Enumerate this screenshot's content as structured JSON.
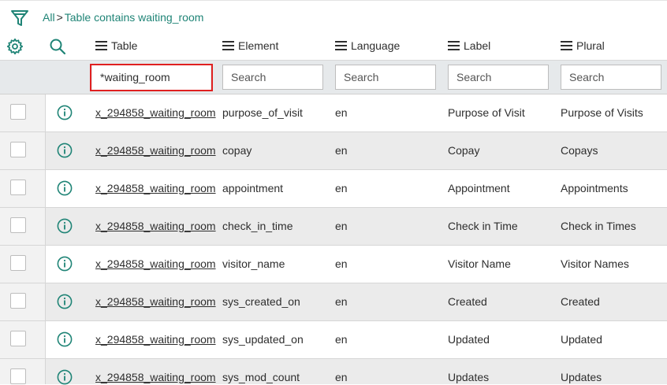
{
  "breadcrumb": {
    "all": "All",
    "separator": ">",
    "condition": "Table contains waiting_room"
  },
  "columns": [
    {
      "label": "Table",
      "search_value": "*waiting_room",
      "search_placeholder": "Search"
    },
    {
      "label": "Element",
      "search_value": "",
      "search_placeholder": "Search"
    },
    {
      "label": "Language",
      "search_value": "",
      "search_placeholder": "Search"
    },
    {
      "label": "Label",
      "search_value": "",
      "search_placeholder": "Search"
    },
    {
      "label": "Plural",
      "search_value": "",
      "search_placeholder": "Search"
    }
  ],
  "rows": [
    {
      "table": "x_294858_waiting_room",
      "element": "purpose_of_visit",
      "language": "en",
      "label": "Purpose of Visit",
      "plural": "Purpose of Visits"
    },
    {
      "table": "x_294858_waiting_room",
      "element": "copay",
      "language": "en",
      "label": "Copay",
      "plural": "Copays"
    },
    {
      "table": "x_294858_waiting_room",
      "element": "appointment",
      "language": "en",
      "label": "Appointment",
      "plural": "Appointments"
    },
    {
      "table": "x_294858_waiting_room",
      "element": "check_in_time",
      "language": "en",
      "label": "Check in Time",
      "plural": "Check in Times"
    },
    {
      "table": "x_294858_waiting_room",
      "element": "visitor_name",
      "language": "en",
      "label": "Visitor Name",
      "plural": "Visitor Names"
    },
    {
      "table": "x_294858_waiting_room",
      "element": "sys_created_on",
      "language": "en",
      "label": "Created",
      "plural": "Created"
    },
    {
      "table": "x_294858_waiting_room",
      "element": "sys_updated_on",
      "language": "en",
      "label": "Updated",
      "plural": "Updated"
    },
    {
      "table": "x_294858_waiting_room",
      "element": "sys_mod_count",
      "language": "en",
      "label": "Updates",
      "plural": "Updates"
    }
  ],
  "icons": {
    "filter": "funnel-icon",
    "settings": "gear-icon",
    "search": "search-icon",
    "column_menu": "menu-icon",
    "row_info": "info-icon"
  },
  "colors": {
    "accent": "#1f8476",
    "highlight": "#e02020",
    "row_alt": "#ebebeb",
    "search_row": "#e6e9eb"
  }
}
